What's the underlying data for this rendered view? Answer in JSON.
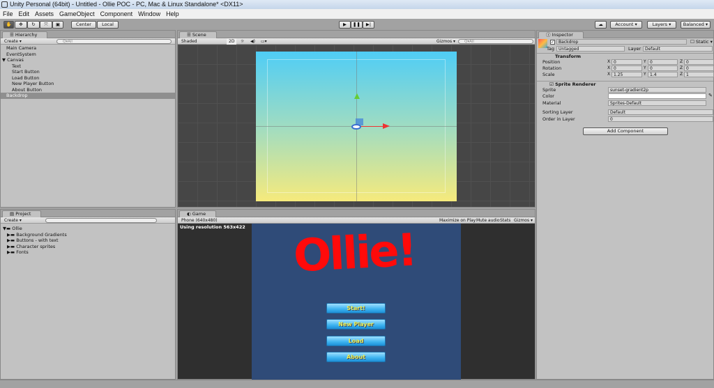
{
  "window": {
    "title": "Unity Personal (64bit) - Untitled - Ollie POC - PC, Mac & Linux Standalone* <DX11>"
  },
  "menu": [
    "File",
    "Edit",
    "Assets",
    "GameObject",
    "Component",
    "Window",
    "Help"
  ],
  "toolbar": {
    "center": "Center",
    "local": "Local",
    "account": "Account",
    "layers": "Layers",
    "layout": "Balanced"
  },
  "hierarchy": {
    "tab": "Hierarchy",
    "create": "Create",
    "search": "Q▾All",
    "items": [
      {
        "label": "Main Camera"
      },
      {
        "label": "EventSystem"
      },
      {
        "label": "▼ Canvas"
      },
      {
        "label": "Text"
      },
      {
        "label": "Start Button"
      },
      {
        "label": "Load Button"
      },
      {
        "label": "New Player Button"
      },
      {
        "label": "About Button"
      },
      {
        "label": "Backdrop"
      }
    ]
  },
  "scene": {
    "tab": "Scene",
    "shading": "Shaded",
    "mode2d": "2D",
    "gizmos": "Gizmos",
    "search": "Q▾All"
  },
  "inspector": {
    "tab": "Inspector",
    "object_name": "Backdrop",
    "static": "Static",
    "tag_label": "Tag",
    "tag": "Untagged",
    "layer_label": "Layer",
    "layer": "Default",
    "transform": {
      "title": "Transform",
      "rows": [
        {
          "label": "Position",
          "x": "0",
          "y": "0",
          "z": "0"
        },
        {
          "label": "Rotation",
          "x": "0",
          "y": "0",
          "z": "0"
        },
        {
          "label": "Scale",
          "x": "1.25",
          "y": "1.4",
          "z": "1"
        }
      ]
    },
    "sprite_renderer": {
      "title": "Sprite Renderer",
      "sprite_label": "Sprite",
      "sprite": "sunset-gradient2p",
      "color_label": "Color",
      "material_label": "Material",
      "material": "Sprites-Default",
      "sorting_label": "Sorting Layer",
      "sorting": "Default",
      "order_label": "Order in Layer",
      "order": "0"
    },
    "add_component": "Add Component"
  },
  "project": {
    "tab": "Project",
    "create": "Create",
    "items": [
      {
        "label": "Ollie"
      },
      {
        "label": "Background Gradients"
      },
      {
        "label": "Buttons - with text"
      },
      {
        "label": "Character sprites"
      },
      {
        "label": "Fonts"
      }
    ]
  },
  "game": {
    "tab": "Game",
    "aspect": "Phone (640x480)",
    "maximize": "Maximize on Play",
    "mute": "Mute audio",
    "stats": "Stats",
    "gizmos": "Gizmos",
    "resolution": "Using resolution 563x422",
    "logo": "Ollie!",
    "buttons": [
      "Start!",
      "New Player",
      "Load",
      "About"
    ],
    "bg_color": "#2f4b78",
    "logo_color": "#ff0a0a"
  }
}
